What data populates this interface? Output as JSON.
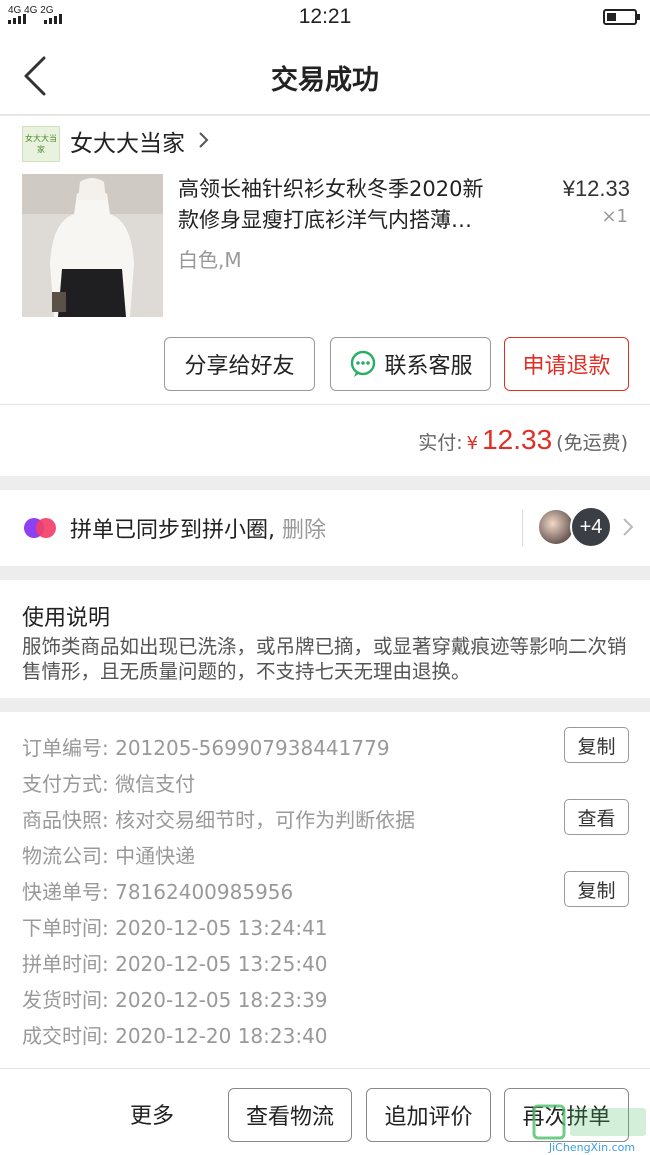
{
  "status_bar": {
    "network": "4G 4G  2G",
    "time": "12:21"
  },
  "nav": {
    "title": "交易成功"
  },
  "shop": {
    "logo_text": "女大大当家",
    "name": "女大大当家"
  },
  "product": {
    "title_line1": "高领长袖针织衫女秋冬季2020新",
    "title_line2": "款修身显瘦打底衫洋气内搭薄…",
    "price": "¥12.33",
    "quantity": "×1",
    "spec": "白色,M"
  },
  "actions": {
    "share": "分享给好友",
    "contact": "联系客服",
    "refund": "申请退款"
  },
  "payment": {
    "label": "实付:",
    "currency": "¥",
    "amount": "12.33",
    "note": "(免运费)"
  },
  "group_sync": {
    "text": "拼单已同步到拼小圈,",
    "delete": "删除",
    "more_count": "+4"
  },
  "usage": {
    "title": "使用说明",
    "text": "服饰类商品如出现已洗涤，或吊牌已摘，或显著穿戴痕迹等影响二次销售情形，且无质量问题的，不支持七天无理由退换。"
  },
  "order_info": {
    "rows": [
      {
        "label": "订单编号:",
        "value": "201205-569907938441779"
      },
      {
        "label": "支付方式:",
        "value": "微信支付"
      },
      {
        "label": "商品快照:",
        "value": "核对交易细节时，可作为判断依据"
      },
      {
        "label": "物流公司:",
        "value": "中通快递"
      },
      {
        "label": "快递单号:",
        "value": "78162400985956"
      },
      {
        "label": "下单时间:",
        "value": "2020-12-05 13:24:41"
      },
      {
        "label": "拼单时间:",
        "value": "2020-12-05 13:25:40"
      },
      {
        "label": "发货时间:",
        "value": "2020-12-05 18:23:39"
      },
      {
        "label": "成交时间:",
        "value": "2020-12-20 18:23:40"
      }
    ],
    "copy_label": "复制",
    "view_label": "查看"
  },
  "bottom_bar": {
    "more": "更多",
    "logistics": "查看物流",
    "review": "追加评价",
    "reorder": "再次拼单"
  },
  "watermark": {
    "text": "JiChengXin.com"
  },
  "colors": {
    "accent_red": "#e02e24",
    "wechat_green": "#2aae67"
  }
}
